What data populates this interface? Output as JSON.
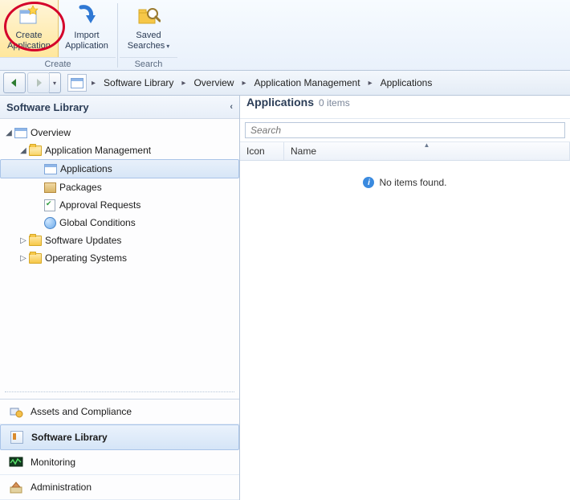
{
  "ribbon": {
    "groups": [
      {
        "label": "Create",
        "buttons": [
          {
            "id": "create-application",
            "line1": "Create",
            "line2": "Application",
            "icon": "create-app-icon"
          },
          {
            "id": "import-application",
            "line1": "Import",
            "line2": "Application",
            "icon": "import-app-icon"
          }
        ]
      },
      {
        "label": "Search",
        "buttons": [
          {
            "id": "saved-searches",
            "line1": "Saved",
            "line2": "Searches",
            "icon": "saved-searches-icon",
            "dropdown": true
          }
        ]
      }
    ]
  },
  "breadcrumbs": {
    "items": [
      "Software Library",
      "Overview",
      "Application Management",
      "Applications"
    ]
  },
  "left": {
    "title": "Software Library",
    "tree": [
      {
        "depth": 1,
        "label": "Overview",
        "icon": "overview-icon",
        "twist": "expanded"
      },
      {
        "depth": 2,
        "label": "Application Management",
        "icon": "folder-open",
        "twist": "expanded"
      },
      {
        "depth": 3,
        "label": "Applications",
        "icon": "app-window-icon",
        "twist": "none",
        "selected": true
      },
      {
        "depth": 3,
        "label": "Packages",
        "icon": "package-icon",
        "twist": "none"
      },
      {
        "depth": 3,
        "label": "Approval Requests",
        "icon": "approval-icon",
        "twist": "none"
      },
      {
        "depth": 3,
        "label": "Global Conditions",
        "icon": "globe-icon",
        "twist": "none"
      },
      {
        "depth": 2,
        "label": "Software Updates",
        "icon": "folder",
        "twist": "collapsed"
      },
      {
        "depth": 2,
        "label": "Operating Systems",
        "icon": "folder",
        "twist": "collapsed"
      }
    ],
    "wunderbar": [
      {
        "id": "assets",
        "label": "Assets and Compliance",
        "icon": "assets-icon"
      },
      {
        "id": "library",
        "label": "Software Library",
        "icon": "library-icon",
        "selected": true
      },
      {
        "id": "monitor",
        "label": "Monitoring",
        "icon": "monitoring-icon"
      },
      {
        "id": "admin",
        "label": "Administration",
        "icon": "admin-icon"
      }
    ]
  },
  "content": {
    "title": "Applications",
    "count_label": "0 items",
    "search_placeholder": "Search",
    "columns": [
      "Icon",
      "Name"
    ],
    "empty_message": "No items found."
  }
}
